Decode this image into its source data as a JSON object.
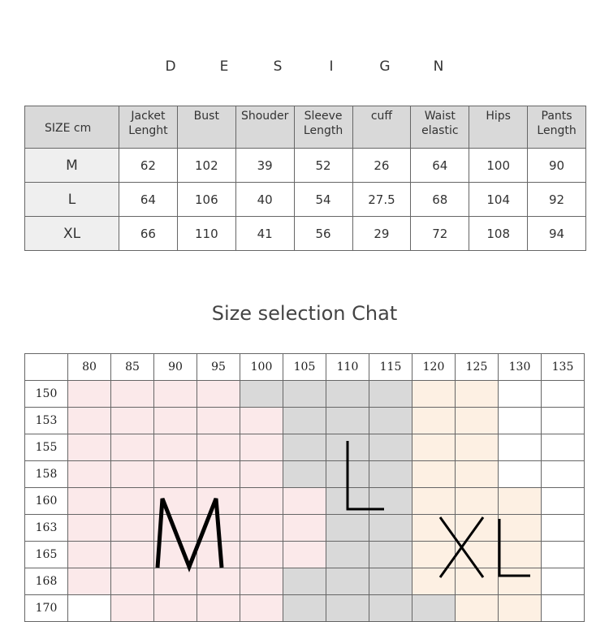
{
  "design_title": [
    "D",
    "E",
    "S",
    "I",
    "G",
    "N"
  ],
  "spec_table": {
    "corner": "SIZE    cm",
    "headers": [
      [
        "Jacket",
        "Lenght"
      ],
      [
        "Bust",
        ""
      ],
      [
        "Shouder",
        ""
      ],
      [
        "Sleeve",
        "Length"
      ],
      [
        "cuff",
        ""
      ],
      [
        "Waist",
        "elastic"
      ],
      [
        "Hips",
        ""
      ],
      [
        "Pants",
        "Length"
      ]
    ],
    "rows": [
      {
        "size": "M",
        "values": [
          "62",
          "102",
          "39",
          "52",
          "26",
          "64",
          "100",
          "90"
        ]
      },
      {
        "size": "L",
        "values": [
          "64",
          "106",
          "40",
          "54",
          "27.5",
          "68",
          "104",
          "92"
        ]
      },
      {
        "size": "XL",
        "values": [
          "66",
          "110",
          "41",
          "56",
          "29",
          "72",
          "108",
          "94"
        ]
      }
    ]
  },
  "chart_title": "Size selection Chat",
  "size_grid": {
    "columns": [
      "80",
      "85",
      "90",
      "95",
      "100",
      "105",
      "110",
      "115",
      "120",
      "125",
      "130",
      "135"
    ],
    "rows": [
      {
        "label": "150",
        "cells": "ppppggggooww"
      },
      {
        "label": "153",
        "cells": "pppppgggooww"
      },
      {
        "label": "155",
        "cells": "pppppgggooww"
      },
      {
        "label": "158",
        "cells": "pppppgggooww"
      },
      {
        "label": "160",
        "cells": "ppppppggooow"
      },
      {
        "label": "163",
        "cells": "ppppppggooow"
      },
      {
        "label": "165",
        "cells": "ppppppggooow"
      },
      {
        "label": "168",
        "cells": "pppppgggooow"
      },
      {
        "label": "170",
        "cells": "wppppggggoow"
      }
    ],
    "legend_codes": {
      "p": "M",
      "g": "L",
      "o": "XL",
      "w": "none"
    },
    "colors": {
      "M": "#fbe9ea",
      "L": "#d9d9d9",
      "XL": "#fdf0e3",
      "none": "#ffffff"
    },
    "size_labels": [
      "M",
      "L",
      "XL"
    ]
  }
}
